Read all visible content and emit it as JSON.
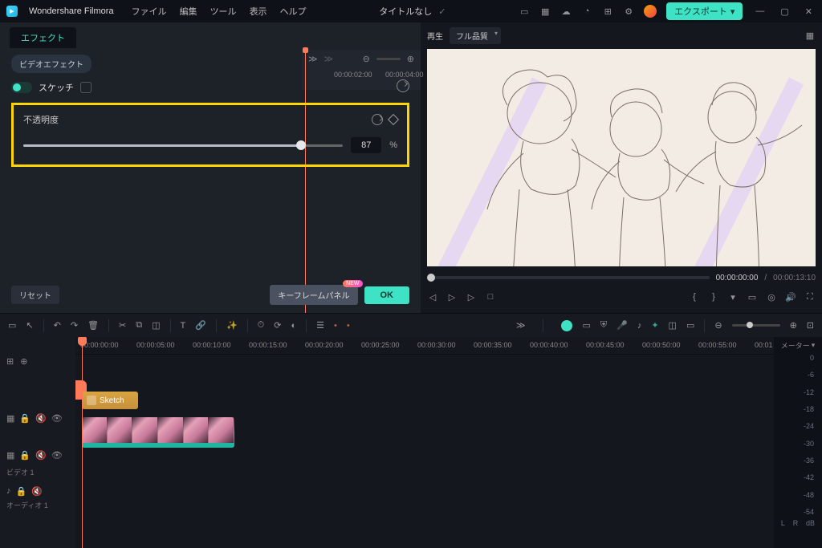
{
  "app": {
    "name": "Wondershare Filmora"
  },
  "menu": [
    "ファイル",
    "編集",
    "ツール",
    "表示",
    "ヘルプ"
  ],
  "title": "タイトルなし",
  "export": "エクスポート",
  "tabs": {
    "effects": "エフェクト"
  },
  "chip": "ビデオエフェクト",
  "effect": {
    "name": "スケッチ",
    "opacity_label": "不透明度",
    "opacity_value": "87",
    "opacity_unit": "%"
  },
  "buttons": {
    "reset": "リセット",
    "keyframe": "キーフレームパネル",
    "kf_badge": "NEW",
    "ok": "OK"
  },
  "mini_tl": {
    "t1": "00:00:02:00",
    "t2": "00:00:04:00"
  },
  "preview": {
    "play_label": "再生",
    "quality": "フル品質",
    "current": "00:00:00:00",
    "total": "00:00:13:10"
  },
  "ruler": [
    "00:00:00:00",
    "00:00:05:00",
    "00:00:10:00",
    "00:00:15:00",
    "00:00:20:00",
    "00:00:25:00",
    "00:00:30:00",
    "00:00:35:00",
    "00:00:40:00",
    "00:00:45:00",
    "00:00:50:00",
    "00:00:55:00",
    "00:01"
  ],
  "tracks": {
    "video": "ビデオ 1",
    "audio": "オーディオ 1"
  },
  "fx_clip": "Sketch",
  "meter": {
    "label": "メーター",
    "scale": [
      "0",
      "-6",
      "-12",
      "-18",
      "-24",
      "-30",
      "-36",
      "-42",
      "-48",
      "-54"
    ],
    "unit": "dB",
    "L": "L",
    "R": "R"
  }
}
